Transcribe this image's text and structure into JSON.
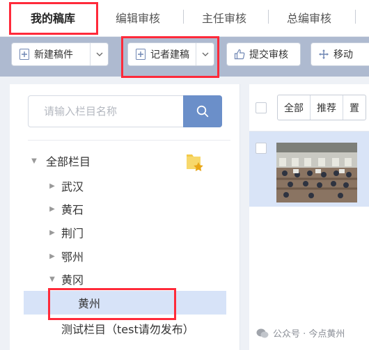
{
  "tabs": [
    {
      "label": "我的稿库",
      "active": true
    },
    {
      "label": "编辑审核",
      "active": false
    },
    {
      "label": "主任审核",
      "active": false
    },
    {
      "label": "总编审核",
      "active": false
    }
  ],
  "toolbar": {
    "new_draft_label": "新建稿件",
    "reporter_draft_label": "记者建稿",
    "submit_review_label": "提交审核",
    "move_label": "移动"
  },
  "search": {
    "placeholder": "请输入栏目名称"
  },
  "tree": {
    "root_label": "全部栏目",
    "items": [
      {
        "label": "武汉",
        "expanded": false
      },
      {
        "label": "黄石",
        "expanded": false
      },
      {
        "label": "荆门",
        "expanded": false
      },
      {
        "label": "鄂州",
        "expanded": false
      },
      {
        "label": "黄冈",
        "expanded": true
      },
      {
        "label": "黄州",
        "selected": true
      },
      {
        "label": "测试栏目（test请勿发布）"
      }
    ]
  },
  "list_filters": [
    "全部",
    "推荐",
    "置"
  ],
  "watermark": "公众号 · 今点黄州",
  "colors": {
    "highlight": "#ff2a3a",
    "toolbar_bg": "#aebad0",
    "search_button": "#6b8fc9",
    "selected_row": "#d7e3f8",
    "folder_icon": "#f0c649"
  }
}
